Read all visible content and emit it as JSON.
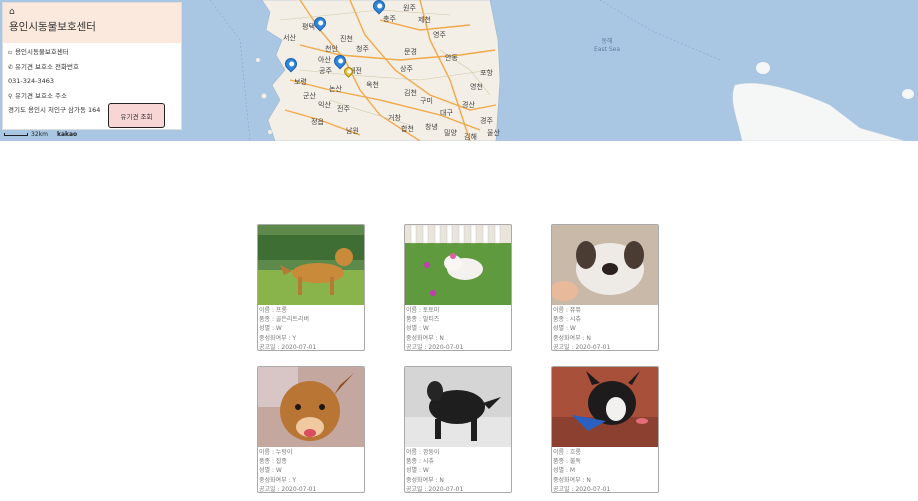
{
  "map": {
    "cities": [
      "서산",
      "평택",
      "천안",
      "아산",
      "청주",
      "충주",
      "제천",
      "원주",
      "진천",
      "공주",
      "보령",
      "대전",
      "논산",
      "옥천",
      "김천",
      "상주",
      "문경",
      "영주",
      "안동",
      "구미",
      "대구",
      "경산",
      "영천",
      "포항",
      "경주",
      "군산",
      "익산",
      "전주",
      "정읍",
      "남원",
      "거창",
      "합천",
      "창녕",
      "밀양",
      "김해",
      "울산"
    ],
    "sea_label_korean": "동해",
    "sea_label_english": "East Sea",
    "scale_label": "32km",
    "provider": "kakao"
  },
  "info_panel": {
    "title": "용인시동물보호센터",
    "shelter_name": "용인시동물보호센터",
    "phone_label": "유기견 보호소 전화번호",
    "phone": "031-324-3463",
    "address_label": "유기견 보호소 주소",
    "address": "경기도 용인시 처인구 삼가동 164",
    "lookup_button": "유기견 조회"
  },
  "dogs": [
    {
      "name": "이름 : 프롱",
      "breed": "품종 : 골든리트리버",
      "gender": "성별 : W",
      "neutered": "중성화여부 : Y",
      "date": "공고일 : 2020-07-01"
    },
    {
      "name": "이름 : 토토미",
      "breed": "품종 : 말티즈",
      "gender": "성별 : W",
      "neutered": "중성화여부 : N",
      "date": "공고일 : 2020-07-01"
    },
    {
      "name": "이름 : 쮸쮸",
      "breed": "품종 : 시츄",
      "gender": "성별 : W",
      "neutered": "중성화여부 : N",
      "date": "공고일 : 2020-07-01"
    },
    {
      "name": "이름 : 누렁이",
      "breed": "품종 : 잡종",
      "gender": "성별 : W",
      "neutered": "중성화여부 : Y",
      "date": "공고일 : 2020-07-01"
    },
    {
      "name": "이름 : 깜둥이",
      "breed": "품종 : 시츄",
      "gender": "성별 : W",
      "neutered": "중성화여부 : N",
      "date": "공고일 : 2020-07-01"
    },
    {
      "name": "이름 : 흐롱",
      "breed": "품종 : 불독",
      "gender": "성별 : M",
      "neutered": "중성화여부 : N",
      "date": "공고일 : 2020-07-01"
    }
  ]
}
